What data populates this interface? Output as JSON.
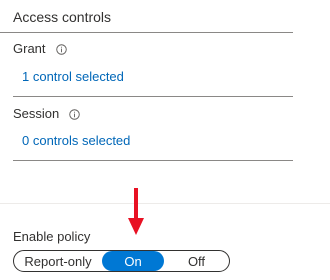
{
  "section": {
    "title": "Access controls"
  },
  "grant": {
    "label": "Grant",
    "info_icon": "info-icon",
    "link": "1 control selected"
  },
  "session": {
    "label": "Session",
    "info_icon": "info-icon",
    "link": "0 controls selected"
  },
  "policy": {
    "label": "Enable policy",
    "options": [
      "Report-only",
      "On",
      "Off"
    ],
    "selected": "On"
  },
  "annotation": {
    "arrow_icon": "arrow-down-icon",
    "arrow_color": "#e81123"
  },
  "colors": {
    "accent": "#0078d4",
    "link": "#0067b8"
  }
}
